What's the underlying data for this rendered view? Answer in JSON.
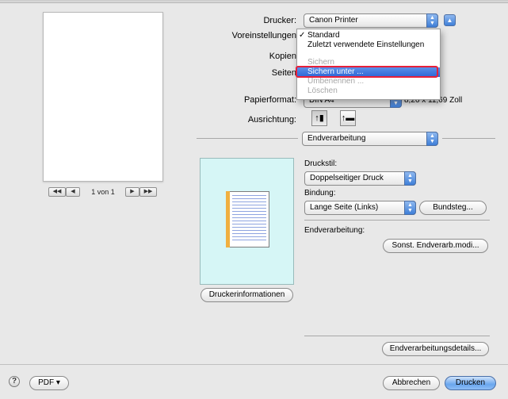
{
  "preview": {
    "page_nav_first": "◀◀",
    "page_nav_prev": "◀",
    "page_label": "1 von 1",
    "page_nav_next": "▶",
    "page_nav_last": "▶▶"
  },
  "printer": {
    "label": "Drucker:",
    "value": "Canon Printer"
  },
  "presets": {
    "label": "Voreinstellungen",
    "menu": [
      {
        "label": "Standard",
        "checked": true,
        "state": "normal"
      },
      {
        "label": "Zuletzt verwendete Einstellungen",
        "state": "normal"
      },
      {
        "label": "Sichern",
        "state": "disabled"
      },
      {
        "label": "Sichern unter ...",
        "state": "highlighted"
      },
      {
        "label": "Umbenennen ...",
        "state": "disabled"
      },
      {
        "label": "Löschen",
        "state": "disabled"
      }
    ]
  },
  "copies": {
    "label": "Kopien"
  },
  "pages": {
    "label": "Seiten"
  },
  "paper": {
    "label": "Papierformat:",
    "value": "DIN A4",
    "size_text": "8,26 x 11,69 Zoll"
  },
  "orientation": {
    "label": "Ausrichtung:"
  },
  "section": {
    "value": "Endverarbeitung"
  },
  "finishing": {
    "print_style_label": "Druckstil:",
    "print_style_value": "Doppelseitiger Druck",
    "binding_label": "Bindung:",
    "binding_value": "Lange Seite (Links)",
    "gutter_button": "Bundsteg...",
    "finishing_label": "Endverarbeitung:",
    "other_finishing_button": "Sonst. Endverarb.modi...",
    "details_button": "Endverarbeitungsdetails...",
    "printer_info_button": "Druckerinformationen"
  },
  "footer": {
    "help_symbol": "?",
    "pdf_button": "PDF ▾",
    "cancel_button": "Abbrechen",
    "print_button": "Drucken"
  },
  "colors": {
    "accent": "#3f7fd8",
    "highlight_ring": "#e6203a",
    "preview_bg": "#d6f6f6"
  }
}
